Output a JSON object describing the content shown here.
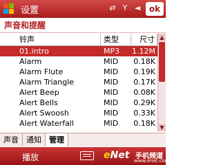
{
  "titlebar": {
    "title": "设置",
    "status_icons": [
      "connectivity-icon",
      "signal-icon",
      "speaker-icon"
    ],
    "ok_label": "ok"
  },
  "section": {
    "title": "声音和提醒"
  },
  "table": {
    "headers": {
      "name": "铃声",
      "type": "类型",
      "size": "尺寸"
    },
    "rows": [
      {
        "name": "01.intro",
        "type": "MP3",
        "size": "1.12M",
        "selected": true
      },
      {
        "name": "Alarm",
        "type": "MID",
        "size": "0.18K"
      },
      {
        "name": "Alarm Flute",
        "type": "MID",
        "size": "0.19K"
      },
      {
        "name": "Alarm Triangle",
        "type": "MID",
        "size": "0.17K"
      },
      {
        "name": "Alert Beep",
        "type": "MID",
        "size": "0.08K"
      },
      {
        "name": "Alert Bells",
        "type": "MID",
        "size": "0.29K"
      },
      {
        "name": "Alert Swoosh",
        "type": "MID",
        "size": "0.33K"
      },
      {
        "name": "Alert Waterfall",
        "type": "MID",
        "size": "0.18K"
      }
    ]
  },
  "tabs": [
    {
      "label": "声音",
      "active": false
    },
    {
      "label": "通知",
      "active": false
    },
    {
      "label": "管理",
      "active": true
    }
  ],
  "menubar": {
    "left_label": "播放",
    "watermark": {
      "brand_e": "e",
      "brand_rest": "Net",
      "channel": "手机频道",
      "url": "www.enet.com.cn"
    }
  },
  "colors": {
    "accent": "#c52a2a",
    "title_gradient_top": "#d24a4a",
    "title_gradient_bottom": "#a91b1b"
  }
}
